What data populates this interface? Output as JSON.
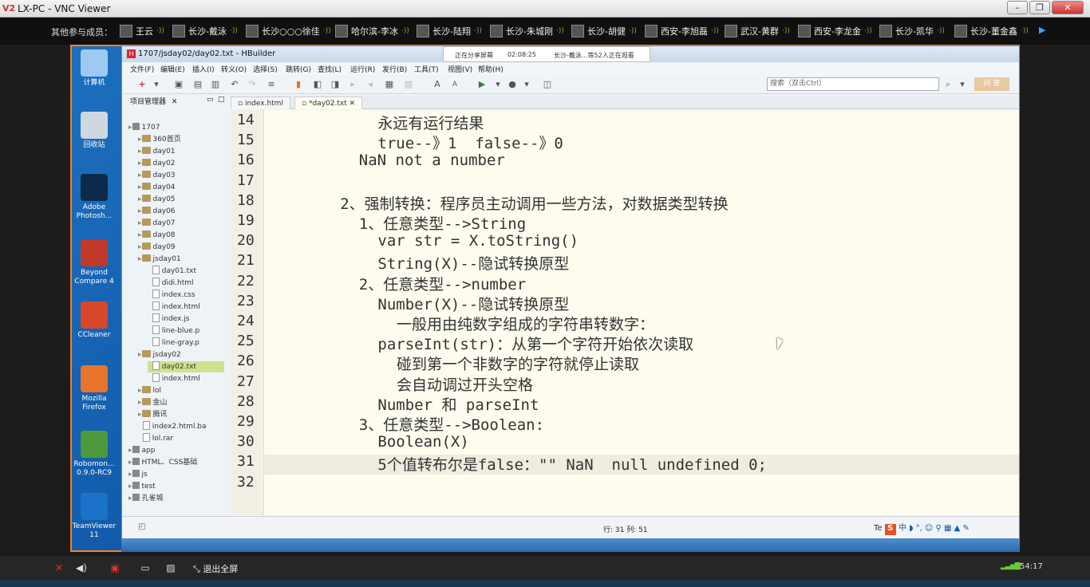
{
  "vnc": {
    "title": "LX-PC - VNC Viewer",
    "logo": "V2",
    "controls": [
      "minimize-icon",
      "maximize-icon",
      "close-icon"
    ]
  },
  "members": {
    "label": "其他参与成员：",
    "items": [
      "王云",
      "长沙-戴泳",
      "长沙○○○徐佳",
      "哈尔滨-李冰",
      "长沙-陆翔",
      "长沙-朱城刚",
      "长沙-胡健",
      "西安-李旭磊",
      "武汉-黄群",
      "西安-李龙金",
      "长沙-凯华",
      "长沙-董金鑫"
    ]
  },
  "desktop_icons": [
    "计算机",
    "回收站",
    "Adobe Photosh...",
    "Beyond Compare 4",
    "CCleaner",
    "Mozilla Firefox",
    "Robomon... 0.9.0-RC9",
    "TeamViewer 11"
  ],
  "hbuilder": {
    "title": "1707/jsday02/day02.txt - HBuilder",
    "share": {
      "status": "正在分享屏幕",
      "time": "02:08:25",
      "viewers": "长沙-戴泳...等52人正在观看"
    },
    "menu": [
      "文件(F)",
      "编辑(E)",
      "插入(I)",
      "转义(O)",
      "选择(S)",
      "跳转(G)",
      "查找(L)",
      "运行(R)",
      "发行(B)",
      "工具(T)",
      "视图(V)",
      "帮助(H)"
    ],
    "search_placeholder": "搜索（双击Ctrl）",
    "search_button": "问 答",
    "project_panel_title": "项目管理器",
    "tree": [
      {
        "label": "1707",
        "kind": "project",
        "depth": 0
      },
      {
        "label": "360首页",
        "kind": "folder",
        "depth": 1
      },
      {
        "label": "day01",
        "kind": "folder",
        "depth": 1
      },
      {
        "label": "day02",
        "kind": "folder",
        "depth": 1
      },
      {
        "label": "day03",
        "kind": "folder",
        "depth": 1
      },
      {
        "label": "day04",
        "kind": "folder",
        "depth": 1
      },
      {
        "label": "day05",
        "kind": "folder",
        "depth": 1
      },
      {
        "label": "day06",
        "kind": "folder",
        "depth": 1
      },
      {
        "label": "day07",
        "kind": "folder",
        "depth": 1
      },
      {
        "label": "day08",
        "kind": "folder",
        "depth": 1
      },
      {
        "label": "day09",
        "kind": "folder",
        "depth": 1
      },
      {
        "label": "jsday01",
        "kind": "folder",
        "depth": 1
      },
      {
        "label": "day01.txt",
        "kind": "file",
        "depth": 2
      },
      {
        "label": "didi.html",
        "kind": "file",
        "depth": 2
      },
      {
        "label": "index.css",
        "kind": "file",
        "depth": 2
      },
      {
        "label": "index.html",
        "kind": "file",
        "depth": 2
      },
      {
        "label": "index.js",
        "kind": "file",
        "depth": 2
      },
      {
        "label": "line-blue.p",
        "kind": "file",
        "depth": 2
      },
      {
        "label": "line-gray.p",
        "kind": "file",
        "depth": 2
      },
      {
        "label": "jsday02",
        "kind": "folder",
        "depth": 1
      },
      {
        "label": "day02.txt",
        "kind": "file",
        "depth": 2,
        "selected": true
      },
      {
        "label": "index.html",
        "kind": "file",
        "depth": 2
      },
      {
        "label": "lol",
        "kind": "folder",
        "depth": 1
      },
      {
        "label": "金山",
        "kind": "folder",
        "depth": 1
      },
      {
        "label": "腾讯",
        "kind": "folder",
        "depth": 1
      },
      {
        "label": "index2.html.ba",
        "kind": "file",
        "depth": 1
      },
      {
        "label": "lol.rar",
        "kind": "file",
        "depth": 1
      },
      {
        "label": "app",
        "kind": "project",
        "depth": 0
      },
      {
        "label": "HTML、CSS基础",
        "kind": "project",
        "depth": 0
      },
      {
        "label": "js",
        "kind": "project",
        "depth": 0
      },
      {
        "label": "test",
        "kind": "project",
        "depth": 0
      },
      {
        "label": "孔雀城",
        "kind": "project",
        "depth": 0
      }
    ],
    "tabs": [
      "index.html",
      "*day02.txt"
    ],
    "editor_lines": [
      {
        "n": "14",
        "indent": 8,
        "text": "永远有运行结果"
      },
      {
        "n": "15",
        "indent": 8,
        "text": "true--》1  false--》0"
      },
      {
        "n": "16",
        "indent": 6,
        "text": "NaN not a number"
      },
      {
        "n": "17",
        "indent": 0,
        "text": ""
      },
      {
        "n": "18",
        "indent": 4,
        "text": "2、强制转换：程序员主动调用一些方法，对数据类型转换"
      },
      {
        "n": "19",
        "indent": 6,
        "text": "1、任意类型-->String"
      },
      {
        "n": "20",
        "indent": 8,
        "text": "var str = X.toString()"
      },
      {
        "n": "21",
        "indent": 8,
        "text": "String(X)--隐试转换原型"
      },
      {
        "n": "22",
        "indent": 6,
        "text": "2、任意类型-->number"
      },
      {
        "n": "23",
        "indent": 8,
        "text": "Number(X)--隐试转换原型"
      },
      {
        "n": "24",
        "indent": 10,
        "text": "一般用由纯数字组成的字符串转数字："
      },
      {
        "n": "25",
        "indent": 8,
        "text": "parseInt(str)：从第一个字符开始依次读取"
      },
      {
        "n": "26",
        "indent": 10,
        "text": "碰到第一个非数字的字符就停止读取"
      },
      {
        "n": "27",
        "indent": 10,
        "text": "会自动调过开头空格"
      },
      {
        "n": "28",
        "indent": 8,
        "text": "Number 和 parseInt"
      },
      {
        "n": "29",
        "indent": 6,
        "text": "3、任意类型-->Boolean:"
      },
      {
        "n": "30",
        "indent": 8,
        "text": "Boolean(X)"
      },
      {
        "n": "31",
        "indent": 8,
        "text": "5个值转布尔是false：\"\" NaN  null undefined 0;"
      },
      {
        "n": "32",
        "indent": 0,
        "text": ""
      }
    ],
    "cursor_position": "行: 31 列: 51",
    "ime_label": "Te"
  },
  "vnc_bottom": {
    "exit_fullscreen": "退出全屏",
    "elapsed": "54:17"
  }
}
